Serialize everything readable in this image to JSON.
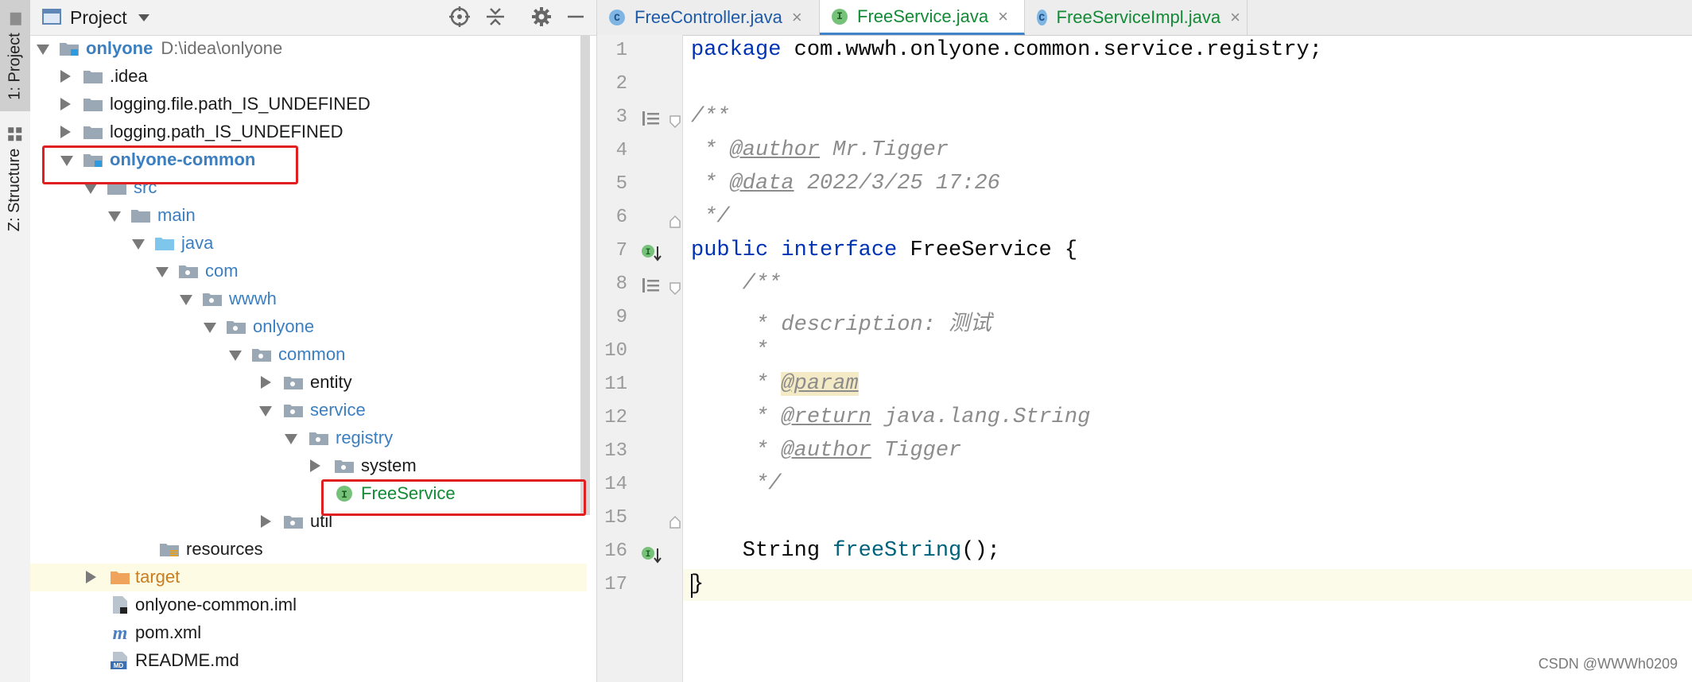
{
  "toolwindow": {
    "project_tab": "1: Project",
    "structure_tab": "Z: Structure"
  },
  "project_panel": {
    "title": "Project"
  },
  "tree": [
    {
      "label": "onlyone",
      "path": "D:\\idea\\onlyone"
    },
    {
      "label": ".idea"
    },
    {
      "label": "logging.file.path_IS_UNDEFINED"
    },
    {
      "label": "logging.path_IS_UNDEFINED"
    },
    {
      "label": "onlyone-common"
    },
    {
      "label": "src"
    },
    {
      "label": "main"
    },
    {
      "label": "java"
    },
    {
      "label": "com"
    },
    {
      "label": "wwwh"
    },
    {
      "label": "onlyone"
    },
    {
      "label": "common"
    },
    {
      "label": "entity"
    },
    {
      "label": "service"
    },
    {
      "label": "registry"
    },
    {
      "label": "system"
    },
    {
      "label": "FreeService"
    },
    {
      "label": "util"
    },
    {
      "label": "resources"
    },
    {
      "label": "target"
    },
    {
      "label": "onlyone-common.iml"
    },
    {
      "label": "pom.xml"
    },
    {
      "label": "README.md"
    }
  ],
  "tabs": [
    {
      "label": "FreeController.java",
      "icon": "C",
      "close": "×"
    },
    {
      "label": "FreeService.java",
      "icon": "I",
      "close": "×"
    },
    {
      "label": "FreeServiceImpl.java",
      "icon": "C",
      "close": "×"
    }
  ],
  "line_numbers": [
    "1",
    "2",
    "3",
    "4",
    "5",
    "6",
    "7",
    "8",
    "9",
    "10",
    "11",
    "12",
    "13",
    "14",
    "15",
    "16",
    "17"
  ],
  "code": {
    "l1_kw": "package",
    "l1_rest": " com.wwwh.onlyone.common.service.registry;",
    "l3": "/**",
    "l4_a": " * ",
    "l4_tag": "@author",
    "l4_b": " Mr.Tigger",
    "l5_a": " * ",
    "l5_tag": "@data",
    "l5_b": " 2022/3/25 17:26",
    "l6": " */",
    "l7_kw1": "public",
    "l7_kw2": "interface",
    "l7_rest": " FreeService {",
    "l8": "    /**",
    "l9": "     * description: 测试",
    "l10": "     *",
    "l11_a": "     * ",
    "l11_tag": "@param",
    "l12_a": "     * ",
    "l12_tag": "@return",
    "l12_b": " java.lang.String",
    "l13_a": "     * ",
    "l13_tag": "@author",
    "l13_b": " Tigger",
    "l14": "     */",
    "l15_a": "    String ",
    "l15_fn": "freeString",
    "l15_b": "();",
    "l16": "}"
  },
  "watermark": "CSDN @WWWh0209"
}
